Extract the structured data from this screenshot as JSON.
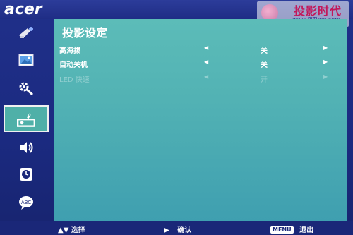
{
  "brand": "acer",
  "watermark": {
    "title": "投影时代",
    "url": "www.PjTime.com"
  },
  "sidebar": {
    "items": [
      {
        "icon": "color-adjust-icon",
        "selected": false
      },
      {
        "icon": "image-icon",
        "selected": false
      },
      {
        "icon": "settings-gear-icon",
        "selected": false
      },
      {
        "icon": "projector-setup-icon",
        "selected": true
      },
      {
        "icon": "speaker-icon",
        "selected": false
      },
      {
        "icon": "clock-icon",
        "selected": false
      },
      {
        "icon": "language-abc-icon",
        "selected": false
      }
    ]
  },
  "panel": {
    "title": "投影设定",
    "rows": [
      {
        "label": "高海拔",
        "left_arrow": "◀",
        "value": "关",
        "right_arrow": "▶",
        "enabled": true
      },
      {
        "label": "自动关机",
        "left_arrow": "◀",
        "value": "关",
        "right_arrow": "▶",
        "enabled": true
      },
      {
        "label": "LED 快速",
        "left_arrow": "◀",
        "value": "开",
        "right_arrow": "▶",
        "enabled": false
      }
    ]
  },
  "footer": {
    "select_arrows": "▲▼",
    "select_label": "选择",
    "confirm_arrow": "▶",
    "confirm_label": "确认",
    "menu_key": "MENU",
    "exit_label": "退出"
  },
  "colors": {
    "frame": "#1a2778",
    "panel": "#52b2b4",
    "selected_item": "#4fb0a8",
    "text": "#ffffff"
  }
}
